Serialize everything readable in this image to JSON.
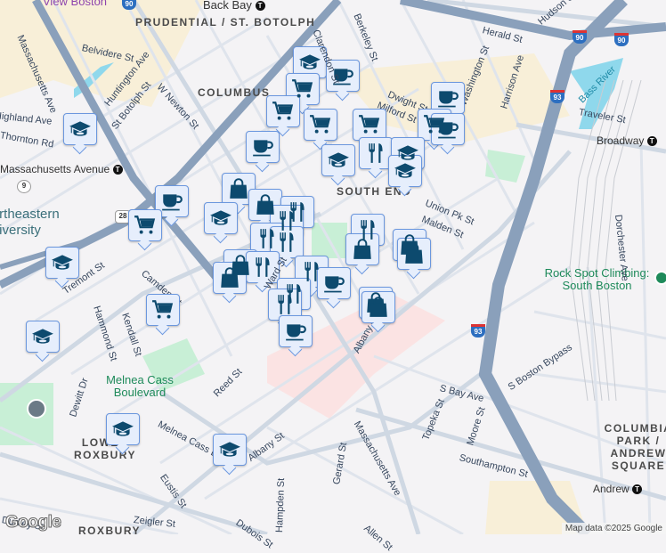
{
  "map": {
    "neighborhoods": [
      "PRUDENTIAL / ST. BOTOLPH",
      "COLUMBUS",
      "SOUTH END",
      "LOWER ROXBURY",
      "ROXBURY",
      "COLUMBIA PARK / ANDREW SQUARE"
    ],
    "streets": [
      "Belvidere St",
      "Huntington Ave",
      "Massachusetts Ave",
      "St Botolph St",
      "W Newton St",
      "Massachusetts Avenue",
      "Tremont St",
      "Camden St",
      "Hammond St",
      "Kendall St",
      "Dewitt Dr",
      "Reed St",
      "Melnea Cass Blvd",
      "Albany St",
      "Eustis St",
      "Zeigler St",
      "Dudley St",
      "Dubois St",
      "Hampden St",
      "Berkeley St",
      "Clarendon St",
      "Dwight St",
      "Milford St",
      "Washington St",
      "Harrison Ave",
      "Herald St",
      "Hudson St",
      "Traveler St",
      "Union Pk St",
      "Malden St",
      "S Bay Ave",
      "Topeka St",
      "Moore St",
      "Gerard St",
      "Southampton St",
      "S Boston Bypass",
      "Dorchester Ave",
      "Allen St",
      "Bass River",
      "Massachusetts Ave",
      "Ward St",
      "Harrison Ave",
      "Albany St",
      "Thornton Rd",
      "Highland Ave"
    ],
    "transit": [
      "Back Bay",
      "Massachusetts Avenue",
      "Broadway",
      "Andrew"
    ],
    "places": [
      "View Boston",
      "Rock Spot Climbing: South Boston",
      "Melnea Cass Boulevard",
      "Northeastern University"
    ],
    "highways": [
      "90",
      "90",
      "90",
      "93",
      "93",
      "9",
      "28"
    ],
    "attribution": "Map data ©2025 Google",
    "logo": "Google"
  },
  "marker_types": [
    "school",
    "coffee",
    "grocery",
    "restaurant",
    "shopping"
  ],
  "colors": {
    "marker_fill": "#e6eefc",
    "marker_border": "#6b97de",
    "icon": "#0d4a6e",
    "highway": "#8aa0bb",
    "park": "#c8efd6",
    "hospital": "#fbe3e3",
    "commercial": "#f8efd8"
  }
}
